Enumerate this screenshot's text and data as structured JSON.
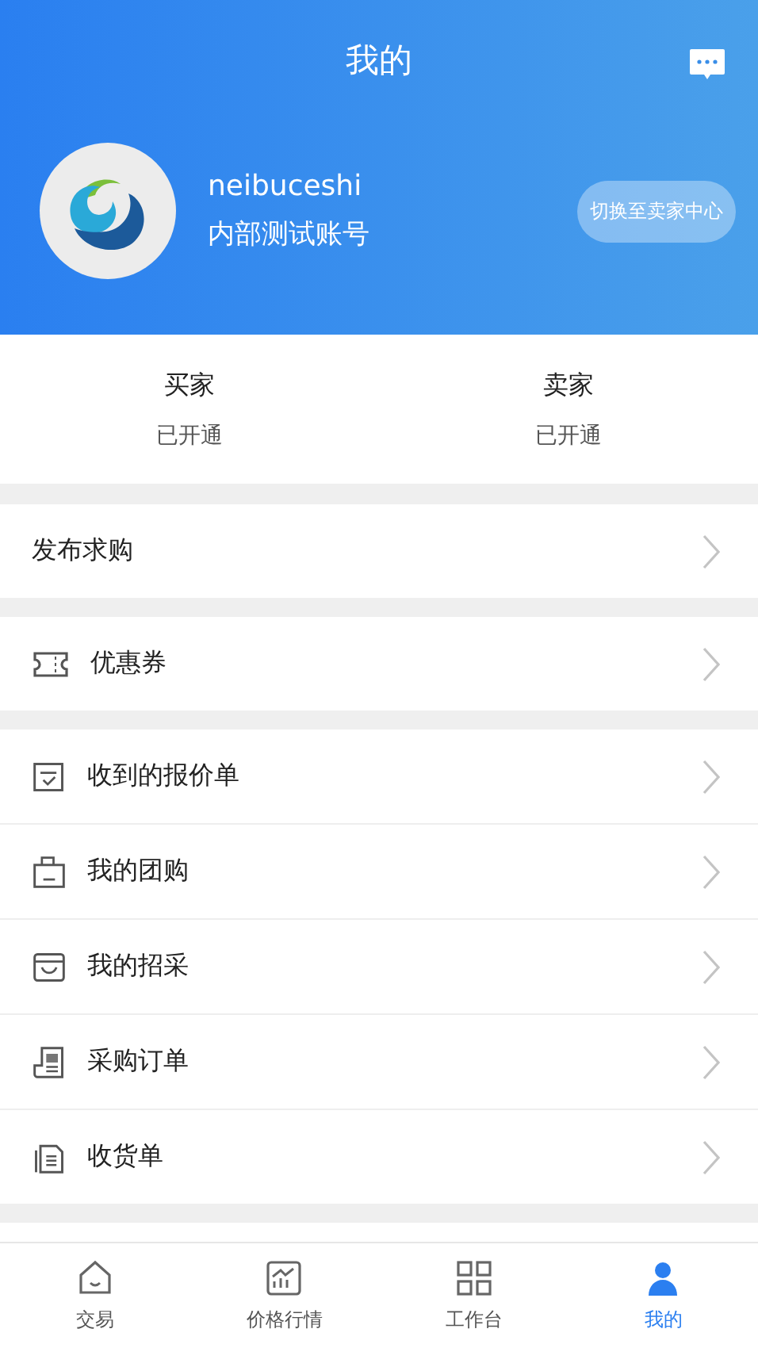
{
  "header": {
    "title": "我的",
    "username": "neibuceshi",
    "account_type": "内部测试账号",
    "switch_button": "切换至卖家中心"
  },
  "roles": [
    {
      "name": "买家",
      "status": "已开通"
    },
    {
      "name": "卖家",
      "status": "已开通"
    }
  ],
  "sections": [
    [
      {
        "label": "发布求购",
        "kind": "plain"
      }
    ],
    [
      {
        "label": "优惠券",
        "kind": "ticket"
      }
    ],
    [
      {
        "label": "收到的报价单",
        "kind": "quote"
      },
      {
        "label": "我的团购",
        "kind": "bag"
      },
      {
        "label": "我的招采",
        "kind": "tray"
      },
      {
        "label": "采购订单",
        "kind": "order"
      },
      {
        "label": "收货单",
        "kind": "receipt"
      }
    ]
  ],
  "tab_bar": [
    {
      "label": "交易",
      "selected": false
    },
    {
      "label": "价格行情",
      "selected": false
    },
    {
      "label": "工作台",
      "selected": false
    },
    {
      "label": "我的",
      "selected": true
    }
  ]
}
